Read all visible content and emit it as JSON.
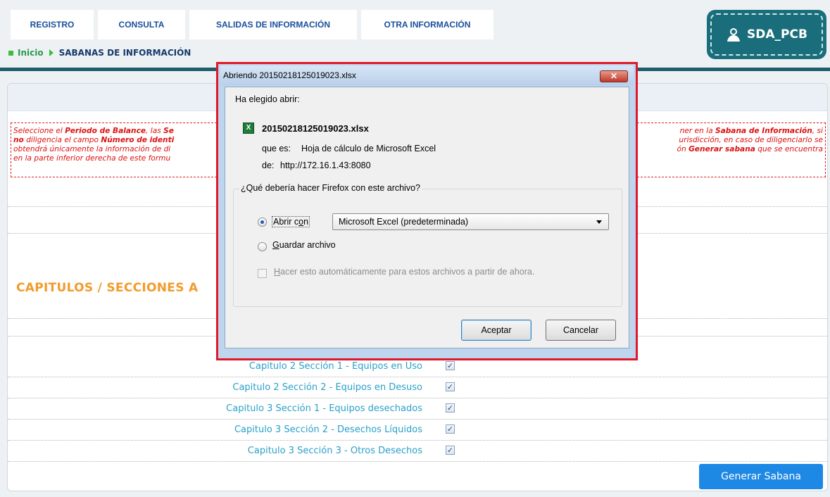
{
  "nav": {
    "tabs": [
      {
        "label": "REGISTRO"
      },
      {
        "label": "CONSULTA"
      },
      {
        "label": "SALIDAS DE INFORMACIÓN"
      },
      {
        "label": "OTRA INFORMACIÓN"
      }
    ]
  },
  "breadcrumb": {
    "home": "Inicio",
    "current": "SABANAS DE INFORMACIÓN"
  },
  "user": {
    "name": "SDA_PCB"
  },
  "instructions": {
    "l1a": "Seleccione el ",
    "l1b": "Periodo de Balance",
    "l1c": ", las ",
    "l1d": "Se",
    "l1e": "ner en la ",
    "l1f": "Sabana de Información",
    "l1g": ", si",
    "l2a": "no",
    "l2b": " diligencia el campo ",
    "l2c": "Número de identi",
    "l2d": "urisdicción, en caso de diligenciarlo se",
    "l3a": "obtendrá únicamente la información de di",
    "l3b": "ón ",
    "l3c": "Generar sabana",
    "l3d": " que se encuentra",
    "l4a": "en la parte inferior derecha de este formu"
  },
  "section_title": "CAPITULOS / SECCIONES A",
  "capitulos": [
    {
      "label": "Capitulo 2 Sección 1 - Equipos en Uso",
      "checked": "✓"
    },
    {
      "label": "Capitulo 2 Sección 2 - Equipos en Desuso",
      "checked": "✓"
    },
    {
      "label": "Capitulo 3 Sección 1 - Equipos desechados",
      "checked": "✓"
    },
    {
      "label": "Capitulo 3 Sección 2 - Desechos Líquidos",
      "checked": "✓"
    },
    {
      "label": "Capitulo 3 Sección 3 - Otros Desechos",
      "checked": "✓"
    }
  ],
  "generate_button": "Generar Sabana",
  "dialog": {
    "title": "Abriendo 20150218125019023.xlsx",
    "close": "✕",
    "chosen": "Ha elegido abrir:",
    "filename": "20150218125019023.xlsx",
    "type_label": "que es:",
    "type_value": "Hoja de cálculo de Microsoft Excel",
    "from_label": "de:",
    "from_value": "http://172.16.1.43:8080",
    "question": "¿Qué debería hacer Firefox con este archivo?",
    "open_with_pre": "Abrir c",
    "open_with_u": "o",
    "open_with_post": "n",
    "app": "Microsoft Excel (predeterminada)",
    "save_u": "G",
    "save_post": "uardar archivo",
    "auto_u": "H",
    "auto_post": "acer esto automáticamente para estos archivos a partir de ahora.",
    "accept": "Aceptar",
    "cancel": "Cancelar"
  },
  "colors": {
    "accent_teal": "#1d5e6a",
    "nav_text": "#1a4f9c",
    "instructions_red": "#d11111",
    "section_orange": "#f29b2b",
    "link_cyan": "#2aa0c8",
    "button_blue": "#1e88e5",
    "highlight_red": "#e0182a"
  }
}
